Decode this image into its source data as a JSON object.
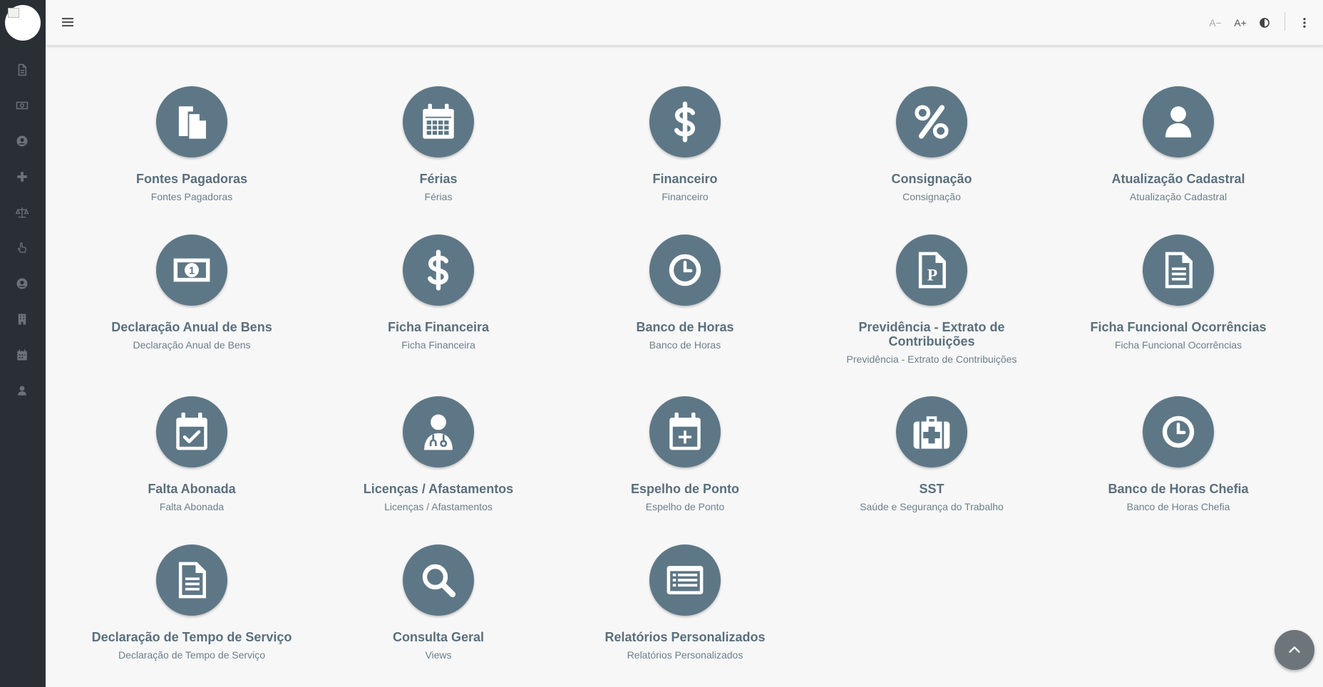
{
  "topbar": {
    "font_decrease": "A−",
    "font_increase": "A+"
  },
  "sidebar": {
    "icons": [
      "document-icon",
      "money-icon",
      "user-circle-icon",
      "plus-icon",
      "scales-icon",
      "hand-pointer-icon",
      "user-circle-icon",
      "building-icon",
      "calendar-icon",
      "user-icon"
    ]
  },
  "tiles": [
    {
      "title": "Fontes Pagadoras",
      "subtitle": "Fontes Pagadoras",
      "icon": "copy-icon"
    },
    {
      "title": "Férias",
      "subtitle": "Férias",
      "icon": "calendar-icon"
    },
    {
      "title": "Financeiro",
      "subtitle": "Financeiro",
      "icon": "dollar-icon"
    },
    {
      "title": "Consignação",
      "subtitle": "Consignação",
      "icon": "percent-icon"
    },
    {
      "title": "Atualização Cadastral",
      "subtitle": "Atualização Cadastral",
      "icon": "user-icon"
    },
    {
      "title": "Declaração Anual de Bens",
      "subtitle": "Declaração Anual de Bens",
      "icon": "money-bill-icon"
    },
    {
      "title": "Ficha Financeira",
      "subtitle": "Ficha Financeira",
      "icon": "dollar-icon"
    },
    {
      "title": "Banco de Horas",
      "subtitle": "Banco de Horas",
      "icon": "clock-icon"
    },
    {
      "title": "Previdência - Extrato de Contribuições",
      "subtitle": "Previdência - Extrato de Contribuições",
      "icon": "file-p-icon"
    },
    {
      "title": "Ficha Funcional Ocorrências",
      "subtitle": "Ficha Funcional Ocorrências",
      "icon": "file-text-icon"
    },
    {
      "title": "Falta Abonada",
      "subtitle": "Falta Abonada",
      "icon": "calendar-check-icon"
    },
    {
      "title": "Licenças / Afastamentos",
      "subtitle": "Licenças / Afastamentos",
      "icon": "doctor-icon"
    },
    {
      "title": "Espelho de Ponto",
      "subtitle": "Espelho de Ponto",
      "icon": "calendar-plus-icon"
    },
    {
      "title": "SST",
      "subtitle": "Saúde e Segurança do Trabalho",
      "icon": "medkit-icon"
    },
    {
      "title": "Banco de Horas Chefia",
      "subtitle": "Banco de Horas Chefia",
      "icon": "clock-icon"
    },
    {
      "title": "Declaração de Tempo de Serviço",
      "subtitle": "Declaração de Tempo de Serviço",
      "icon": "file-text-icon"
    },
    {
      "title": "Consulta Geral",
      "subtitle": "Views",
      "icon": "search-icon"
    },
    {
      "title": "Relatórios Personalizados",
      "subtitle": "Relatórios Personalizados",
      "icon": "list-alt-icon"
    }
  ],
  "colors": {
    "sidebar_bg": "#2a2f35",
    "circle_bg": "#5e7786",
    "title_color": "#5a6f7d"
  }
}
